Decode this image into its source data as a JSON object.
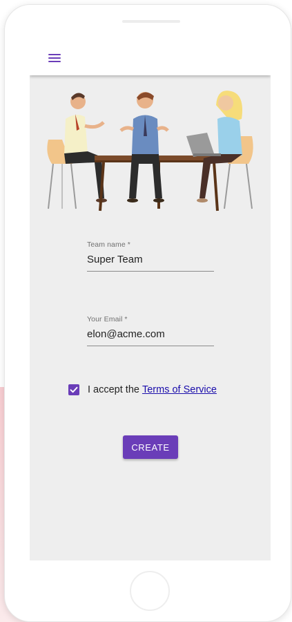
{
  "appbar": {
    "menu_icon": "hamburger-menu-icon",
    "accent_color": "#6a3db8"
  },
  "illustration": {
    "name": "team-meeting-illustration"
  },
  "form": {
    "team_name": {
      "label": "Team name *",
      "value": "Super Team"
    },
    "email": {
      "label": "Your Email *",
      "value": "elon@acme.com"
    },
    "terms": {
      "checked": true,
      "prefix": "I accept the",
      "link_text": "Terms of Service"
    },
    "submit_label": "CREATE"
  },
  "colors": {
    "primary": "#6a3db8",
    "link": "#1a0dab",
    "screen_bg": "#eeeeee"
  }
}
